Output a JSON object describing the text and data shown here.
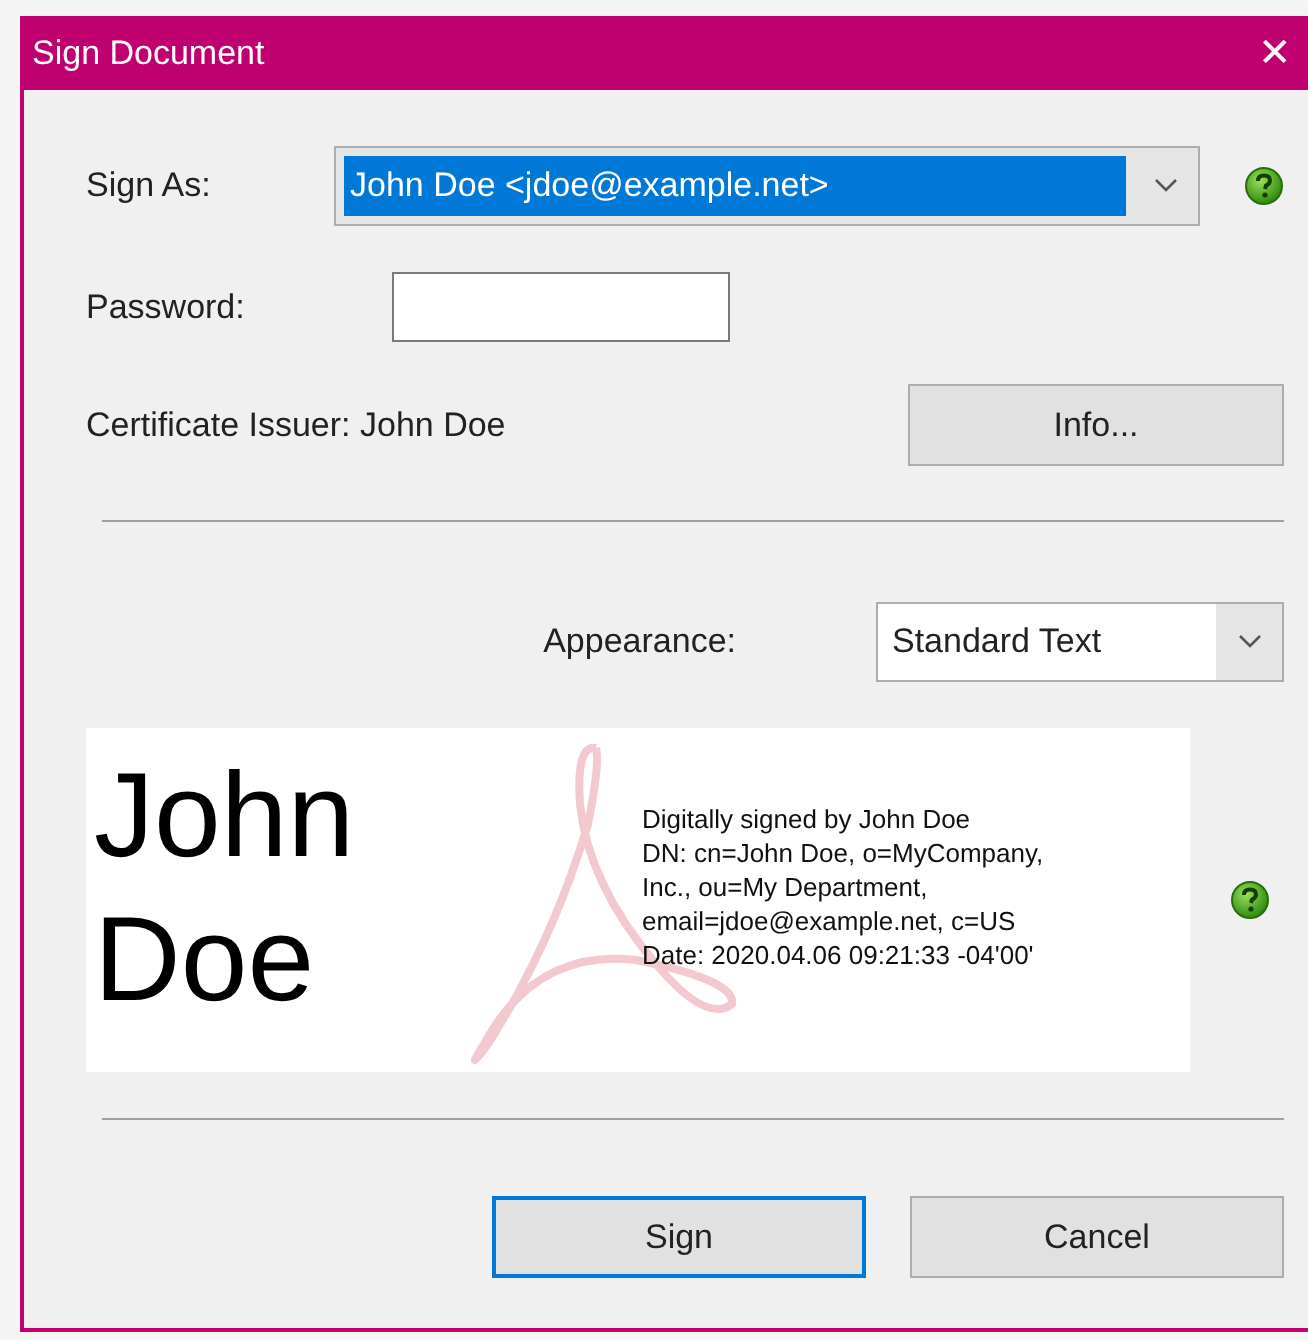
{
  "window": {
    "title": "Sign Document",
    "close": "✕"
  },
  "sign_as": {
    "label": "Sign As:",
    "value": "John Doe <jdoe@example.net>",
    "highlighted": true
  },
  "password": {
    "label": "Password:"
  },
  "certificate": {
    "label": "Certificate Issuer: John Doe",
    "button": "Info..."
  },
  "appearance": {
    "label": "Appearance:",
    "value": "Standard Text"
  },
  "preview": {
    "name_lines": [
      "John",
      "Doe"
    ],
    "details": [
      "Digitally signed by John Doe",
      "DN: cn=John Doe, o=MyCompany,",
      "Inc., ou=My Department,",
      "email=jdoe@example.net, c=US",
      "Date: 2020.04.06 09:21:33 -04'00'"
    ]
  },
  "buttons": [
    {
      "label": "Sign",
      "default": true
    },
    {
      "label": "Cancel",
      "default": false
    }
  ]
}
